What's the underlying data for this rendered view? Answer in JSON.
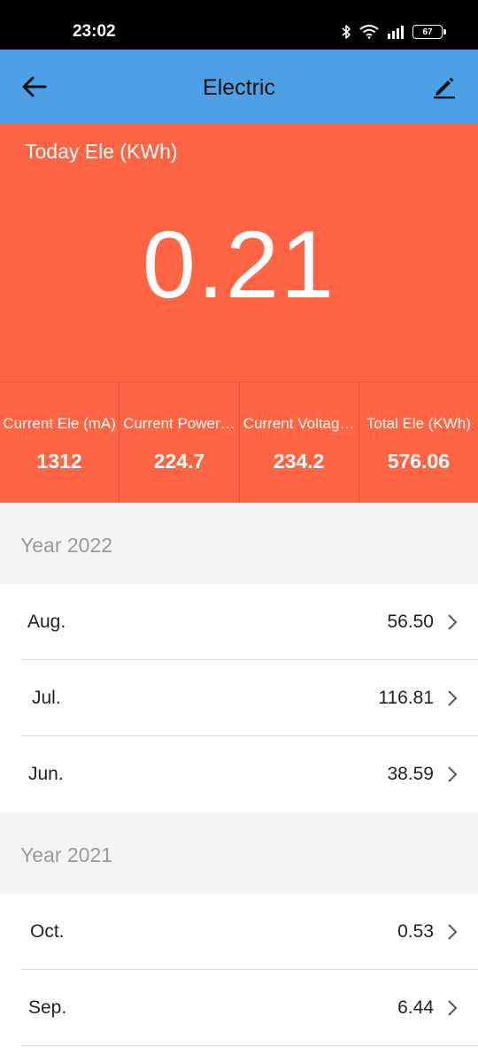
{
  "status_bar": {
    "time": "23:02",
    "battery": "67",
    "icons": [
      "bluetooth-icon",
      "wifi-icon",
      "signal-icon",
      "battery-icon"
    ]
  },
  "app_bar": {
    "title": "Electric",
    "back_icon": "arrow-left-icon",
    "edit_icon": "pencil-icon",
    "color": "#4d9fe6"
  },
  "today": {
    "label": "Today Ele (KWh)",
    "value": "0.21",
    "color": "#ff6444"
  },
  "stats": [
    {
      "label": "Current Ele (mA)",
      "value": "1312"
    },
    {
      "label": "Current Power…",
      "value": "224.7"
    },
    {
      "label": "Current Voltag…",
      "value": "234.2"
    },
    {
      "label": "Total Ele (KWh)",
      "value": "576.06"
    }
  ],
  "years": [
    {
      "label": "Year 2022",
      "months": [
        {
          "name": "Aug.",
          "value": "56.50"
        },
        {
          "name": "Jul.",
          "value": "116.81"
        },
        {
          "name": "Jun.",
          "value": "38.59"
        }
      ]
    },
    {
      "label": "Year 2021",
      "months": [
        {
          "name": "Oct.",
          "value": "0.53"
        },
        {
          "name": "Sep.",
          "value": "6.44"
        }
      ]
    }
  ]
}
